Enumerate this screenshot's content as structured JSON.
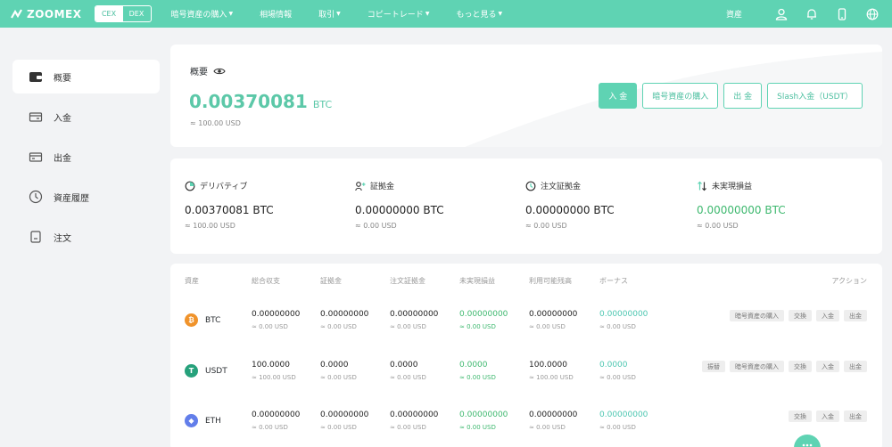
{
  "header": {
    "brand": "ZOOMEX",
    "mode_tabs": [
      "CEX",
      "DEX"
    ],
    "nav": [
      {
        "label": "暗号資産の購入",
        "caret": true
      },
      {
        "label": "相場情報",
        "caret": false
      },
      {
        "label": "取引",
        "caret": true
      },
      {
        "label": "コピートレード",
        "caret": true
      },
      {
        "label": "もっと見る",
        "caret": true
      }
    ],
    "assets_label": "資産",
    "icons": [
      "user-icon",
      "bell-icon",
      "phone-icon",
      "globe-icon"
    ]
  },
  "sidebar": {
    "items": [
      {
        "label": "概要",
        "icon": "wallet-icon",
        "active": true
      },
      {
        "label": "入金",
        "icon": "deposit-icon",
        "active": false
      },
      {
        "label": "出金",
        "icon": "withdraw-icon",
        "active": false
      },
      {
        "label": "資産履歴",
        "icon": "clock-icon",
        "active": false
      },
      {
        "label": "注文",
        "icon": "order-icon",
        "active": false
      }
    ]
  },
  "overview": {
    "title": "概要",
    "amount": "0.00370081",
    "unit": "BTC",
    "usd": "≈ 100.00 USD",
    "actions": [
      "入 金",
      "暗号資産の購入",
      "出 金",
      "Slash入金（USDT）"
    ]
  },
  "summary": [
    {
      "label": "デリバティブ",
      "icon": "derivatives-icon",
      "value": "0.00370081 BTC",
      "usd": "≈ 100.00 USD",
      "green": false
    },
    {
      "label": "証拠金",
      "icon": "margin-icon",
      "value": "0.00000000 BTC",
      "usd": "≈ 0.00 USD",
      "green": false
    },
    {
      "label": "注文証拠金",
      "icon": "order-margin-icon",
      "value": "0.00000000 BTC",
      "usd": "≈ 0.00 USD",
      "green": false
    },
    {
      "label": "未実現損益",
      "icon": "pnl-icon",
      "value": "0.00000000 BTC",
      "usd": "≈ 0.00 USD",
      "green": true
    }
  ],
  "table": {
    "headers": [
      "資産",
      "総合収支",
      "証拠金",
      "注文証拠金",
      "未実現損益",
      "利用可能残高",
      "ボーナス",
      "アクション"
    ],
    "rows": [
      {
        "coin": "BTC",
        "icon": "bitcoin-icon",
        "color": "#f0932b",
        "glyph": "₿",
        "cells": [
          {
            "v": "0.00000000",
            "u": "≈ 0.00 USD"
          },
          {
            "v": "0.00000000",
            "u": "≈ 0.00 USD"
          },
          {
            "v": "0.00000000",
            "u": "≈ 0.00 USD"
          },
          {
            "v": "0.00000000",
            "u": "≈ 0.00 USD"
          },
          {
            "v": "0.00000000",
            "u": "≈ 0.00 USD"
          },
          {
            "v": "0.00000000",
            "u": "≈ 0.00 USD"
          }
        ],
        "actions": [
          "暗号資産の購入",
          "交換",
          "入金",
          "出金"
        ]
      },
      {
        "coin": "USDT",
        "icon": "tether-icon",
        "color": "#26a17b",
        "glyph": "T",
        "cells": [
          {
            "v": "100.0000",
            "u": "≈ 100.00 USD"
          },
          {
            "v": "0.0000",
            "u": "≈ 0.00 USD"
          },
          {
            "v": "0.0000",
            "u": "≈ 0.00 USD"
          },
          {
            "v": "0.0000",
            "u": "≈ 0.00 USD"
          },
          {
            "v": "100.0000",
            "u": "≈ 100.00 USD"
          },
          {
            "v": "0.0000",
            "u": "≈ 0.00 USD"
          }
        ],
        "actions": [
          "振替",
          "暗号資産の購入",
          "交換",
          "入金",
          "出金"
        ]
      },
      {
        "coin": "ETH",
        "icon": "ethereum-icon",
        "color": "#627eea",
        "glyph": "◆",
        "cells": [
          {
            "v": "0.00000000",
            "u": "≈ 0.00 USD"
          },
          {
            "v": "0.00000000",
            "u": "≈ 0.00 USD"
          },
          {
            "v": "0.00000000",
            "u": "≈ 0.00 USD"
          },
          {
            "v": "0.00000000",
            "u": "≈ 0.00 USD"
          },
          {
            "v": "0.00000000",
            "u": "≈ 0.00 USD"
          },
          {
            "v": "0.00000000",
            "u": "≈ 0.00 USD"
          }
        ],
        "actions": [
          "交換",
          "入金",
          "出金"
        ]
      }
    ]
  },
  "colors": {
    "accent": "#5fd3b3",
    "green": "#3db86e",
    "teal": "#4bc6b0"
  }
}
